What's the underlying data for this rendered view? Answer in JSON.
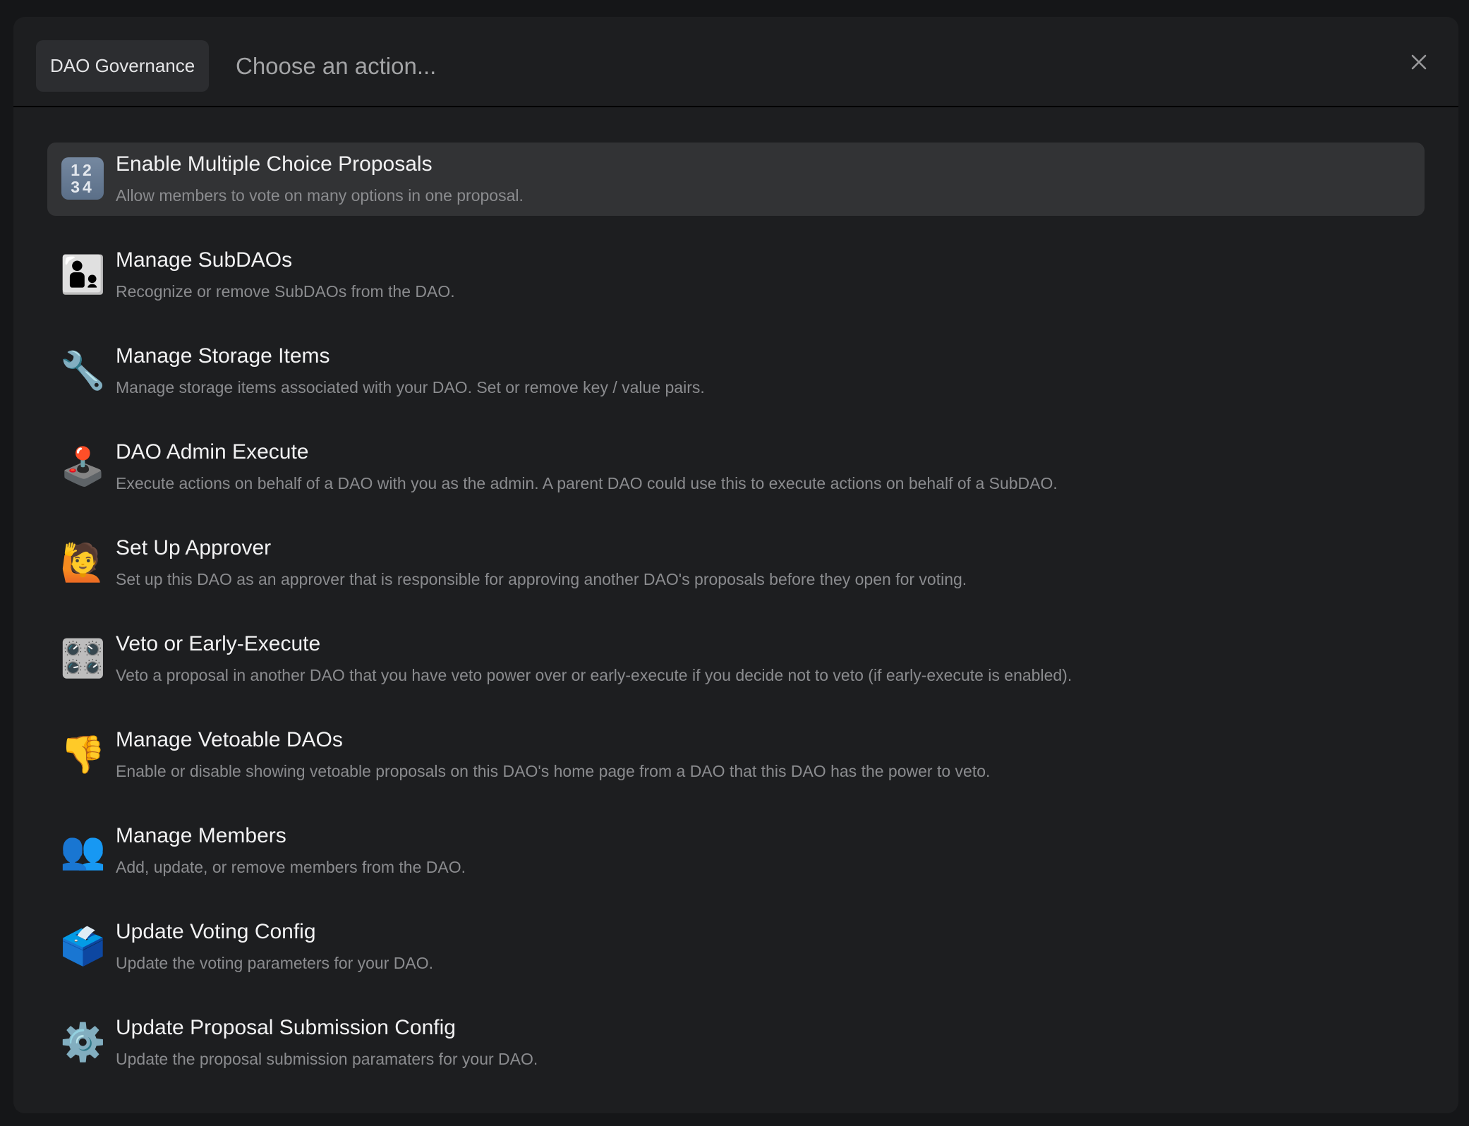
{
  "header": {
    "category_chip": "DAO Governance",
    "search_placeholder": "Choose an action...",
    "search_value": "",
    "close_icon": "close-icon"
  },
  "actions": [
    {
      "icon": "input-numbers-icon",
      "glyph_top": "12",
      "glyph_bottom": "34",
      "title": "Enable Multiple Choice Proposals",
      "description": "Allow members to vote on many options in one proposal.",
      "highlighted": true
    },
    {
      "icon": "family-man-boy-icon",
      "glyph": "👨‍👦",
      "title": "Manage SubDAOs",
      "description": "Recognize or remove SubDAOs from the DAO."
    },
    {
      "icon": "wrench-icon",
      "glyph": "🔧",
      "title": "Manage Storage Items",
      "description": "Manage storage items associated with your DAO. Set or remove key / value pairs."
    },
    {
      "icon": "joystick-icon",
      "glyph": "🕹️",
      "title": "DAO Admin Execute",
      "description": "Execute actions on behalf of a DAO with you as the admin. A parent DAO could use this to execute actions on behalf of a SubDAO."
    },
    {
      "icon": "raising-hand-icon",
      "glyph": "🙋",
      "title": "Set Up Approver",
      "description": "Set up this DAO as an approver that is responsible for approving another DAO's proposals before they open for voting."
    },
    {
      "icon": "control-knobs-icon",
      "glyph": "🎛️",
      "title": "Veto or Early-Execute",
      "description": "Veto a proposal in another DAO that you have veto power over or early-execute if you decide not to veto (if early-execute is enabled)."
    },
    {
      "icon": "thumbs-down-icon",
      "glyph": "👎",
      "title": "Manage Vetoable DAOs",
      "description": "Enable or disable showing vetoable proposals on this DAO's home page from a DAO that this DAO has the power to veto."
    },
    {
      "icon": "busts-in-silhouette-icon",
      "glyph": "👥",
      "title": "Manage Members",
      "description": "Add, update, or remove members from the DAO."
    },
    {
      "icon": "ballot-box-icon",
      "glyph": "🗳️",
      "title": "Update Voting Config",
      "description": "Update the voting parameters for your DAO."
    },
    {
      "icon": "gear-icon",
      "glyph": "⚙️",
      "title": "Update Proposal Submission Config",
      "description": "Update the proposal submission paramaters for your DAO."
    }
  ]
}
